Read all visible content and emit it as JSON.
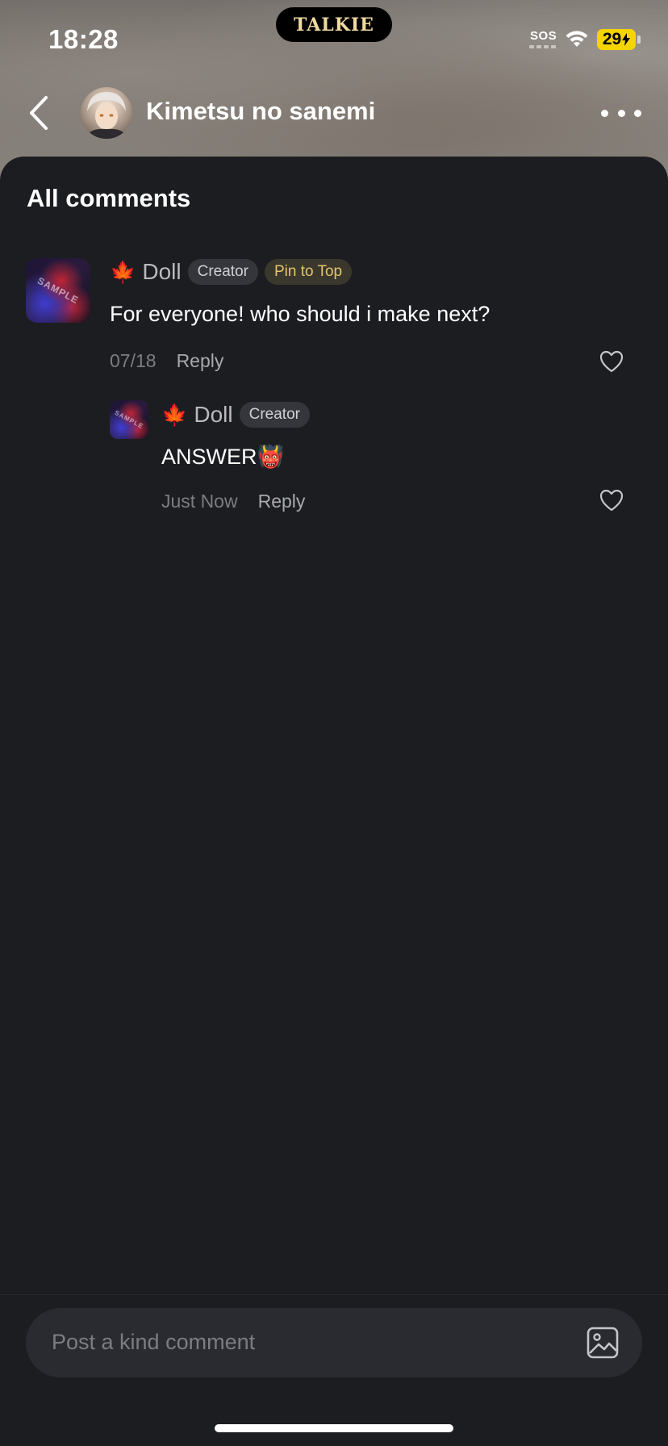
{
  "status_bar": {
    "time": "18:28",
    "island_logo": "TALKIE",
    "sos": "SOS",
    "battery": "29"
  },
  "header": {
    "title": "Kimetsu no sanemi"
  },
  "comments_section": {
    "title": "All comments",
    "comments": [
      {
        "leaf": "🍁",
        "user": "Doll",
        "badge_creator": "Creator",
        "badge_pin": "Pin to Top",
        "text": "For everyone! who should i make next?",
        "date": "07/18",
        "reply_label": "Reply"
      }
    ],
    "replies": [
      {
        "leaf": "🍁",
        "user": "Doll",
        "badge_creator": "Creator",
        "text": "ANSWER👹",
        "date": "Just Now",
        "reply_label": "Reply"
      }
    ],
    "avatar_watermark": "SAMPLE"
  },
  "composer": {
    "placeholder": "Post a kind comment"
  },
  "colors": {
    "background": "#1c1d21",
    "pin_badge_text": "#e6c56a",
    "battery": "#f5d500"
  }
}
